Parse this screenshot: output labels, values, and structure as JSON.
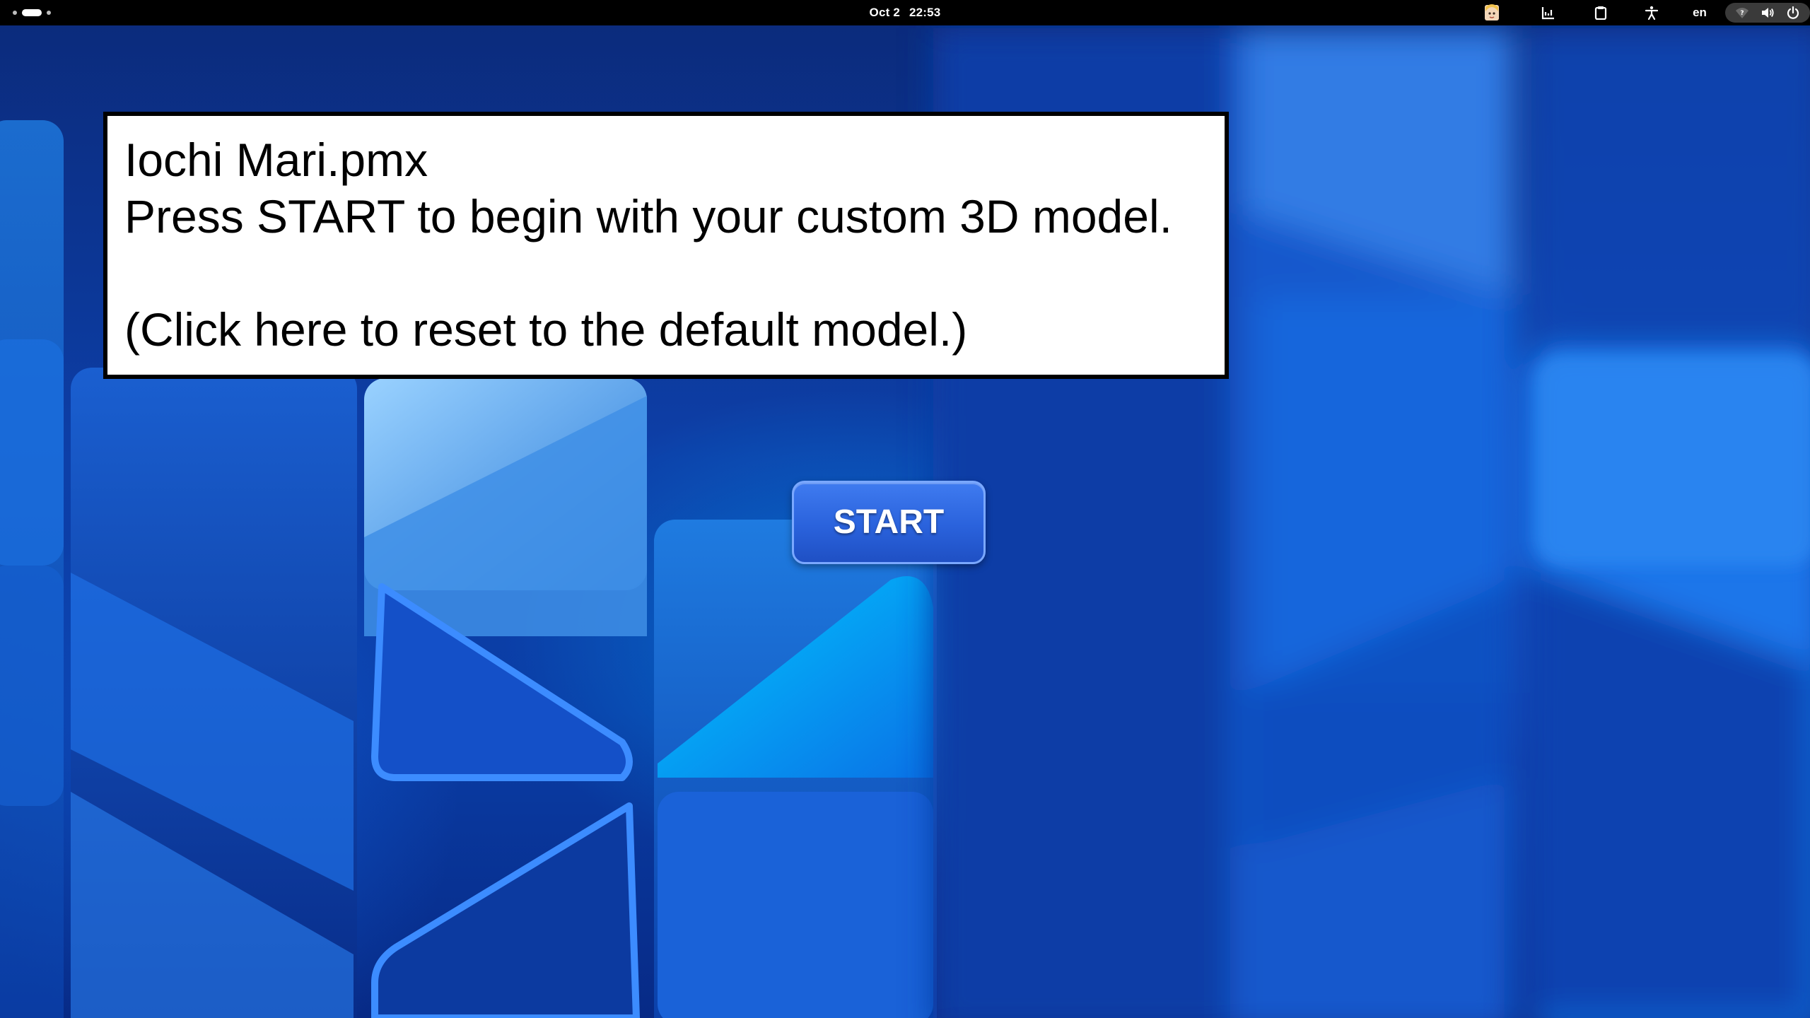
{
  "topbar": {
    "date": "Oct 2",
    "time": "22:53",
    "language": "en",
    "icons": [
      "avatar-icon",
      "chart-icon",
      "clipboard-icon",
      "accessibility-icon",
      "network-question-icon",
      "volume-icon",
      "power-icon"
    ]
  },
  "dialog": {
    "filename": "Iochi Mari.pmx",
    "instruction": "Press START to begin with your custom 3D model.",
    "reset_link": "(Click here to reset to the default model.)"
  },
  "start_button": {
    "label": "START"
  },
  "colors": {
    "topbar_bg": "#000000",
    "dialog_bg": "#ffffff",
    "dialog_border": "#000000",
    "button_blue": "#2a62dc",
    "wallpaper_blue": "#0d3fa8"
  }
}
